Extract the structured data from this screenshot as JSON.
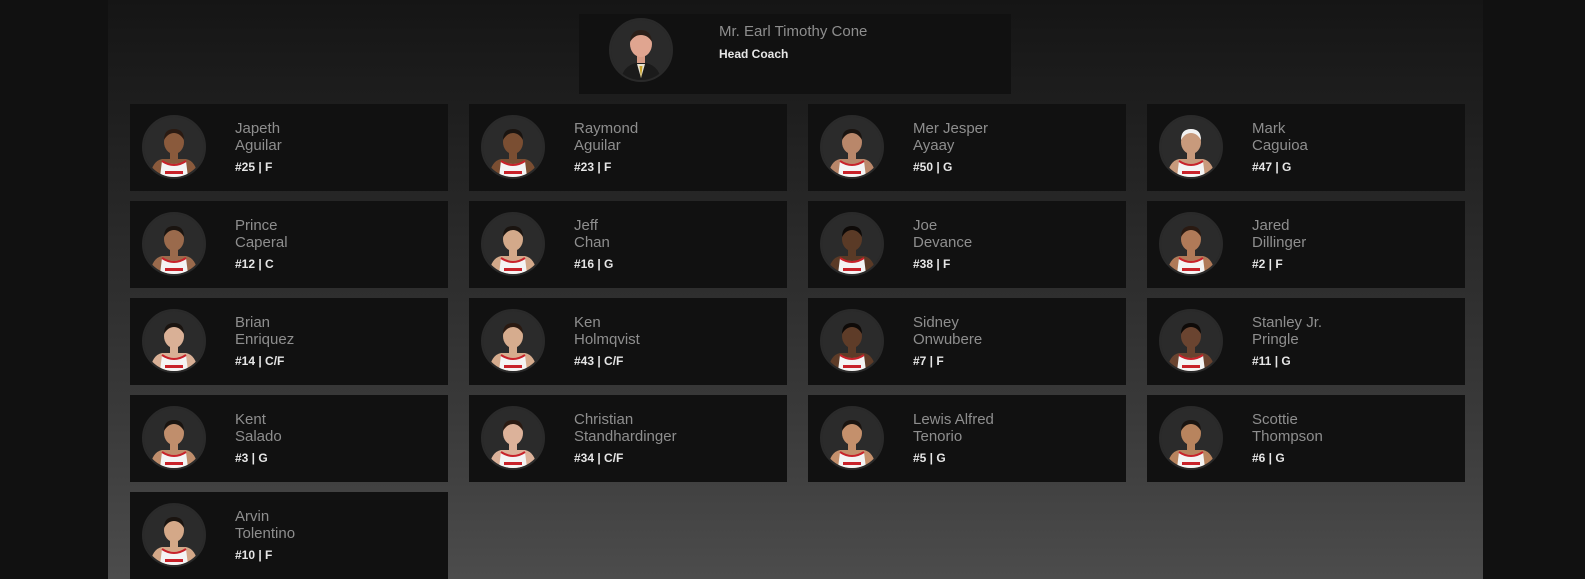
{
  "coach": {
    "name": "Mr. Earl Timothy Cone",
    "role": "Head Coach",
    "photo": "coach-portrait"
  },
  "players": [
    {
      "first": "Japeth",
      "last": "Aguilar",
      "meta": "#25 | F",
      "skin": "#8a5a3c",
      "hair": "#2a1a12"
    },
    {
      "first": "Raymond",
      "last": "Aguilar",
      "meta": "#23 | F",
      "skin": "#7a4e32",
      "hair": "#1a1410"
    },
    {
      "first": "Mer Jesper",
      "last": "Ayaay",
      "meta": "#50 | G",
      "skin": "#b9876a",
      "hair": "#1a1410"
    },
    {
      "first": "Mark",
      "last": "Caguioa",
      "meta": "#47 | G",
      "skin": "#c89a7c",
      "hair": "#f2f2f2"
    },
    {
      "first": "Prince",
      "last": "Caperal",
      "meta": "#12 | C",
      "skin": "#9a6a4c",
      "hair": "#1a1410"
    },
    {
      "first": "Jeff",
      "last": "Chan",
      "meta": "#16 | G",
      "skin": "#d3a98a",
      "hair": "#1a1410"
    },
    {
      "first": "Joe",
      "last": "Devance",
      "meta": "#38 | F",
      "skin": "#5a3a26",
      "hair": "#0e0a08"
    },
    {
      "first": "Jared",
      "last": "Dillinger",
      "meta": "#2 | F",
      "skin": "#b07a58",
      "hair": "#2a1a12"
    },
    {
      "first": "Brian",
      "last": "Enriquez",
      "meta": "#14 | C/F",
      "skin": "#d9b096",
      "hair": "#1a1410"
    },
    {
      "first": "Ken",
      "last": "Holmqvist",
      "meta": "#43 | C/F",
      "skin": "#d6ac8e",
      "hair": "#2a1a12"
    },
    {
      "first": "Sidney",
      "last": "Onwubere",
      "meta": "#7 | F",
      "skin": "#5e3c28",
      "hair": "#0e0a08"
    },
    {
      "first": "Stanley Jr.",
      "last": "Pringle",
      "meta": "#11 | G",
      "skin": "#6a4430",
      "hair": "#0e0a08"
    },
    {
      "first": "Kent",
      "last": "Salado",
      "meta": "#3 | G",
      "skin": "#c08e6c",
      "hair": "#1a1410"
    },
    {
      "first": "Christian",
      "last": "Standhardinger",
      "meta": "#34 | C/F",
      "skin": "#dcb29a",
      "hair": "#2a1a12"
    },
    {
      "first": "Lewis Alfred",
      "last": "Tenorio",
      "meta": "#5 | G",
      "skin": "#c4906c",
      "hair": "#1a1410"
    },
    {
      "first": "Scottie",
      "last": "Thompson",
      "meta": "#6 | G",
      "skin": "#b8845e",
      "hair": "#1a1410"
    },
    {
      "first": "Arvin",
      "last": "Tolentino",
      "meta": "#10 | F",
      "skin": "#d4a888",
      "hair": "#1a1410"
    }
  ],
  "colors": {
    "card_bg": "#111111",
    "name_text": "#8e8e8e",
    "meta_text": "#e6e6e6",
    "jersey_white": "#f4f4f4",
    "jersey_red": "#c8222a"
  }
}
